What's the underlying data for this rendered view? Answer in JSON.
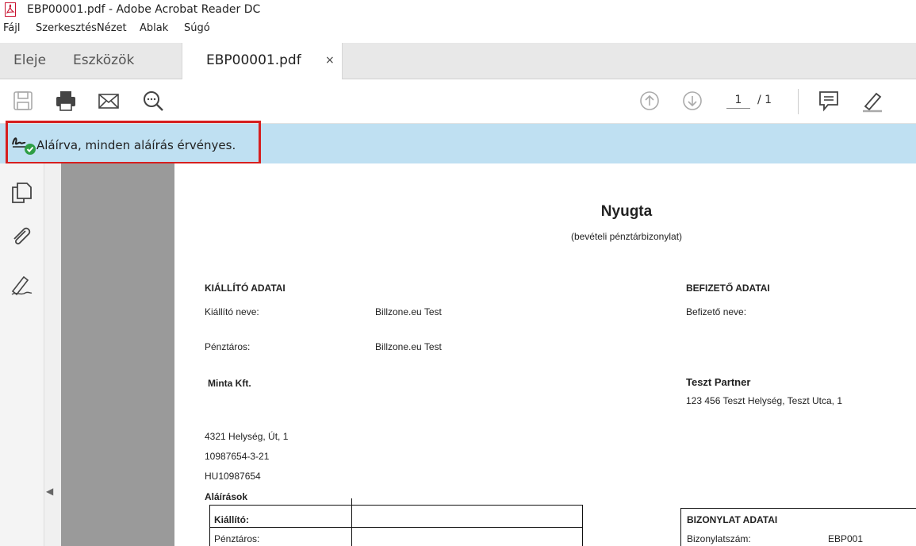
{
  "window": {
    "title": "EBP00001.pdf  - Adobe Acrobat Reader DC",
    "app_icon": "acrobat-pdf-icon"
  },
  "menu": [
    "Fájl",
    "Szerkesztés",
    "Nézet",
    "Ablak",
    "Súgó"
  ],
  "tabs": {
    "home": "Eleje",
    "tools": "Eszközök",
    "document": "EBP00001.pdf",
    "close": "×"
  },
  "toolbar": {
    "icons": [
      "save-icon",
      "print-icon",
      "email-icon",
      "find-icon",
      "page-up-icon",
      "page-down-icon",
      "comment-icon",
      "highlight-pen-icon"
    ],
    "page_current": "1",
    "page_total": "/ 1"
  },
  "signature_banner": {
    "text": "Aláírva, minden aláírás érvényes.",
    "icon": "signature-valid-icon",
    "highlight_color": "#d61f1f",
    "background": "#bfe0f2"
  },
  "side_panel": {
    "icons": [
      "pages-icon",
      "attachments-icon",
      "signatures-icon"
    ],
    "collapse": "◀"
  },
  "document": {
    "title": "Nyugta",
    "subtitle": "(bevételi pénztárbizonylat)",
    "issuer": {
      "heading": "KIÁLLÍTÓ ADATAI",
      "name_label": "Kiállító neve:",
      "name_value": "Billzone.eu Test",
      "cashier_label": "Pénztáros:",
      "cashier_value": "Billzone.eu Test",
      "company": "Minta Kft.",
      "address": "4321 Helység, Út, 1",
      "tax_number": "10987654-3-21",
      "eu_tax_number": "HU10987654"
    },
    "payer": {
      "heading": "BEFIZETŐ ADATAI",
      "name_label": "Befizető neve:",
      "partner": "Teszt Partner",
      "address": "123 456 Teszt Helység, Teszt Utca, 1"
    },
    "signatures": {
      "heading": "Aláírások",
      "rows": [
        "Kiállító:",
        "Pénztáros:"
      ]
    },
    "receipt": {
      "heading": "BIZONYLAT ADATAI",
      "number_label": "Bizonylatszám:",
      "number_value": "EBP001"
    }
  }
}
